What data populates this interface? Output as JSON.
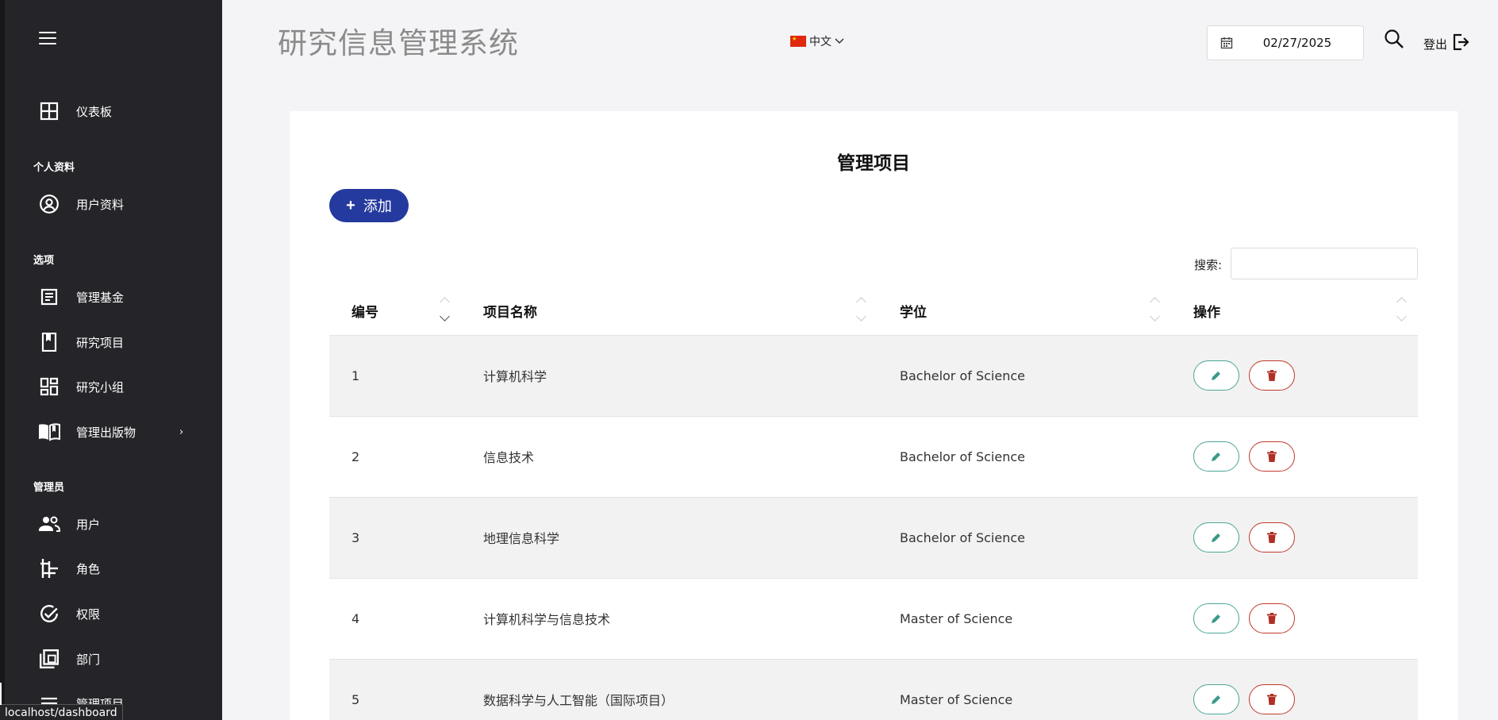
{
  "header": {
    "app_title": "研究信息管理系统",
    "language": "中文",
    "date": "02/27/2025",
    "logout_label": "登出"
  },
  "sidebar": {
    "items": [
      {
        "label": "仪表板",
        "icon": "dashboard-grid-icon"
      },
      {
        "label": "用户资料",
        "icon": "user-circle-icon"
      },
      {
        "label": "管理基金",
        "icon": "document-icon"
      },
      {
        "label": "研究项目",
        "icon": "bookmark-icon"
      },
      {
        "label": "研究小组",
        "icon": "widgets-icon"
      },
      {
        "label": "管理出版物",
        "icon": "open-book-icon"
      },
      {
        "label": "用户",
        "icon": "people-icon"
      },
      {
        "label": "角色",
        "icon": "roles-icon"
      },
      {
        "label": "权限",
        "icon": "check-circle-icon"
      },
      {
        "label": "部门",
        "icon": "copy-icon"
      },
      {
        "label": "管理项目",
        "icon": "list-icon"
      }
    ],
    "sections": [
      "个人资料",
      "选项",
      "管理员"
    ],
    "status_url": "localhost/dashboard"
  },
  "main": {
    "title": "管理项目",
    "add_label": "添加",
    "search_label": "搜索:",
    "search_value": "",
    "columns": [
      "编号",
      "项目名称",
      "学位",
      "操作"
    ],
    "rows": [
      {
        "id": "1",
        "name": "计算机科学",
        "degree": "Bachelor of Science"
      },
      {
        "id": "2",
        "name": "信息技术",
        "degree": "Bachelor of Science"
      },
      {
        "id": "3",
        "name": "地理信息科学",
        "degree": "Bachelor of Science"
      },
      {
        "id": "4",
        "name": "计算机科学与信息技术",
        "degree": "Master of Science"
      },
      {
        "id": "5",
        "name": "数据科学与人工智能（国际项目）",
        "degree": "Master of Science"
      }
    ]
  },
  "colors": {
    "sidebar_bg": "#252529",
    "accent": "#253a9e",
    "edit": "#4aa695",
    "delete": "#c0392b"
  }
}
